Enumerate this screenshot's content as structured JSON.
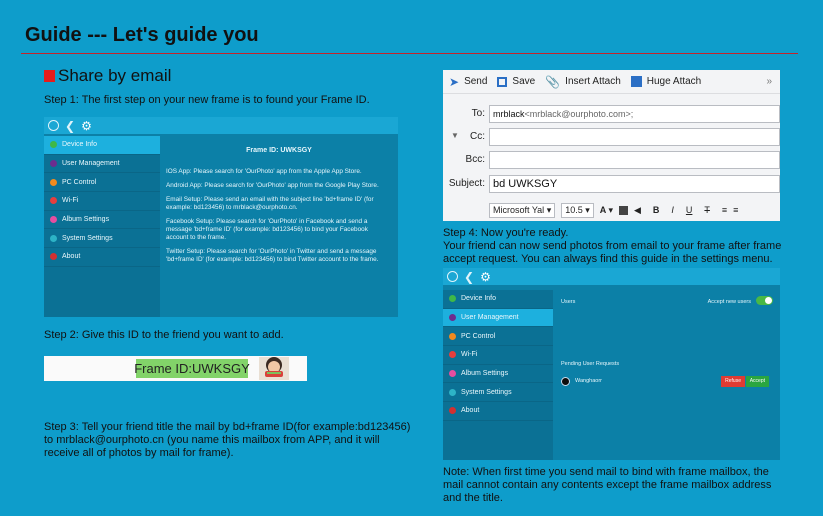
{
  "heading": {
    "title": "Guide --- Let's guide you"
  },
  "section": {
    "title": "Share by email"
  },
  "steps": {
    "step1": "Step 1: The first step on your new frame is to found your Frame ID.",
    "step2": "Step 2: Give this ID to the friend you want to add.",
    "step3_lines": [
      "Step 3: Tell your friend title the mail by bd+frame ID(for example:bd123456)",
      "to mrblack@ourphoto.cn (you name this mailbox from APP, and it will",
      "receive all of photos by mail for frame)."
    ],
    "step4_lines": [
      "Step 4: Now you're ready.",
      "Your friend can now send photos from email to your frame after frame",
      "accept request. You can always find this guide in the settings menu."
    ],
    "note_lines": [
      "Note: When first time you send mail to bind with frame mailbox, the",
      "mail cannot contain any contents except the frame mailbox address",
      "and the title."
    ]
  },
  "device1": {
    "menu": [
      {
        "label": "Device Info",
        "color": "#3fb848"
      },
      {
        "label": "User Management",
        "color": "#6c2d8f"
      },
      {
        "label": "PC Control",
        "color": "#f08a1d"
      },
      {
        "label": "Wi-Fi",
        "color": "#e63e3e"
      },
      {
        "label": "Album Settings",
        "color": "#e64ea0"
      },
      {
        "label": "System Settings",
        "color": "#2db3c6"
      },
      {
        "label": "About",
        "color": "#d23030"
      }
    ],
    "frame_id_title": "Frame ID: UWKSGY",
    "paragraphs": [
      "IOS App: Please search for 'OurPhoto' app from the Apple App Store.",
      "Android App: Please search for 'OurPhoto' app from the Google Play Store.",
      "Email Setup: Please send an email with the subject line 'bd+frame ID' (for example: bd123456) to mrblack@ourphoto.cn.",
      "Facebook Setup: Please search for 'OurPhoto' in Facebook and send a message 'bd+frame ID' (for example: bd123456) to bind your Facebook account to the frame.",
      "Twitter Setup: Please search for 'OurPhoto' in Twitter and send a message 'bd+frame ID' (for example: bd123456) to bind Twitter account to the frame."
    ]
  },
  "frame_id_pill": "Frame ID:UWKSGY",
  "email": {
    "toolbar": [
      "Send",
      "Save",
      "Insert Attach",
      "Huge Attach"
    ],
    "more": "»",
    "to_label": "To:",
    "to_name": "mrblack",
    "to_addr": "<mrblack@ourphoto.com>;",
    "cc_label": "Cc:",
    "bcc_label": "Bcc:",
    "subject_label": "Subject:",
    "subject_value": "bd UWKSGY",
    "font_name": "Microsoft Yal",
    "font_size": "10.5"
  },
  "device2": {
    "menu": [
      {
        "label": "Device Info",
        "color": "#3fb848"
      },
      {
        "label": "User Management",
        "color": "#6c2d8f"
      },
      {
        "label": "PC Control",
        "color": "#f08a1d"
      },
      {
        "label": "Wi-Fi",
        "color": "#e63e3e"
      },
      {
        "label": "Album Settings",
        "color": "#e64ea0"
      },
      {
        "label": "System Settings",
        "color": "#2db3c6"
      },
      {
        "label": "About",
        "color": "#d23030"
      }
    ],
    "users_label": "Users",
    "accept_new_users": "Accept new users",
    "pending_label": "Pending User Requests",
    "pending_user": "Wanghaorr",
    "refuse": "Refuse",
    "accept": "Accept"
  },
  "colors": {
    "page_bg": "#0e9dcb",
    "rule": "#c4232a",
    "bullet": "#e61c1c",
    "pill": "#82d369",
    "selected": "#1db0de"
  }
}
